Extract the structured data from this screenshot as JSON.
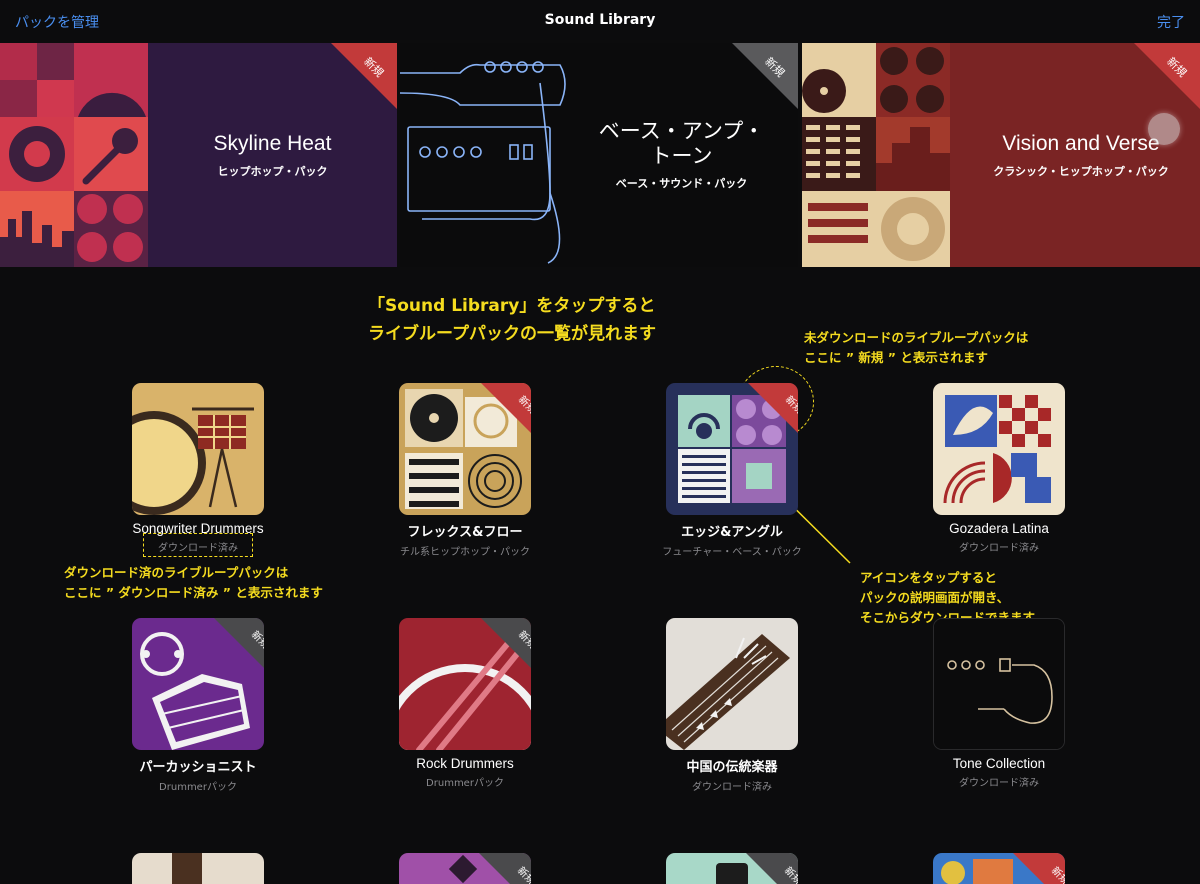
{
  "nav": {
    "left_label": "パックを管理",
    "title": "Sound Library",
    "right_label": "完了",
    "link_color": "#4a8ff0"
  },
  "new_badge": "新規",
  "banners": [
    {
      "title": "Skyline Heat",
      "subtitle": "ヒップホップ・パック",
      "is_new": true
    },
    {
      "title_line1": "ベース・アンプ・",
      "title_line2": "トーン",
      "subtitle": "ベース・サウンド・パック",
      "is_new": true
    },
    {
      "title": "Vision and Verse",
      "subtitle": "クラシック・ヒップホップ・パック",
      "is_new": true
    }
  ],
  "annotations": {
    "main_line1": "「Sound Library」をタップすると",
    "main_line2": "ライブループパックの一覧が見れます",
    "new_line1": "未ダウンロードのライブループパックは",
    "new_line2": "ここに ” 新規 ” と表示されます",
    "downloaded_line1": "ダウンロード済のライブループパックは",
    "downloaded_line2": "ここに ” ダウンロード済み ” と表示されます",
    "tap_line1": "アイコンをタップすると",
    "tap_line2": "パックの説明画面が開き、",
    "tap_line3": "そこからダウンロードできます",
    "color": "#f5dc1f"
  },
  "packs": [
    {
      "name": "Songwriter Drummers",
      "status": "ダウンロード済み",
      "is_new": false
    },
    {
      "name": "フレックス&フロー",
      "status": "チル系ヒップホップ・パック",
      "is_new": true
    },
    {
      "name": "エッジ&アングル",
      "status": "フューチャー・ベース・パック",
      "is_new": true
    },
    {
      "name": "Gozadera Latina",
      "status": "ダウンロード済み",
      "is_new": false
    },
    {
      "name": "パーカッショニスト",
      "status": "Drummerパック",
      "is_new": true
    },
    {
      "name": "Rock Drummers",
      "status": "Drummerパック",
      "is_new": true
    },
    {
      "name": "中国の伝統楽器",
      "status": "ダウンロード済み",
      "is_new": false
    },
    {
      "name": "Tone Collection",
      "status": "ダウンロード済み",
      "is_new": false
    }
  ]
}
